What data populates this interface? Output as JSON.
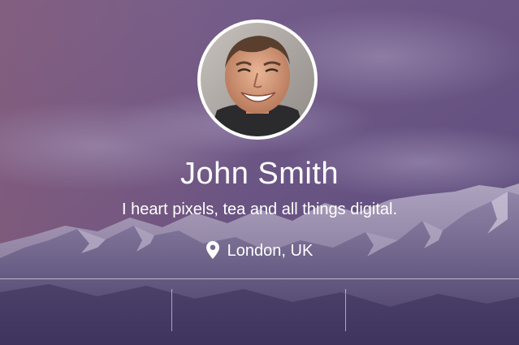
{
  "profile": {
    "name": "John Smith",
    "bio": "I heart pixels, tea and all things digital.",
    "location": "London, UK",
    "location_icon": "map-pin-icon",
    "avatar_icon": "avatar",
    "background": "mountain-landscape"
  },
  "colors": {
    "overlay_top": "#6a5582",
    "overlay_mid": "#6e4f78",
    "overlay_bottom": "#4a3f6b",
    "text": "#ffffff",
    "divider": "#ffffff"
  },
  "stats": []
}
